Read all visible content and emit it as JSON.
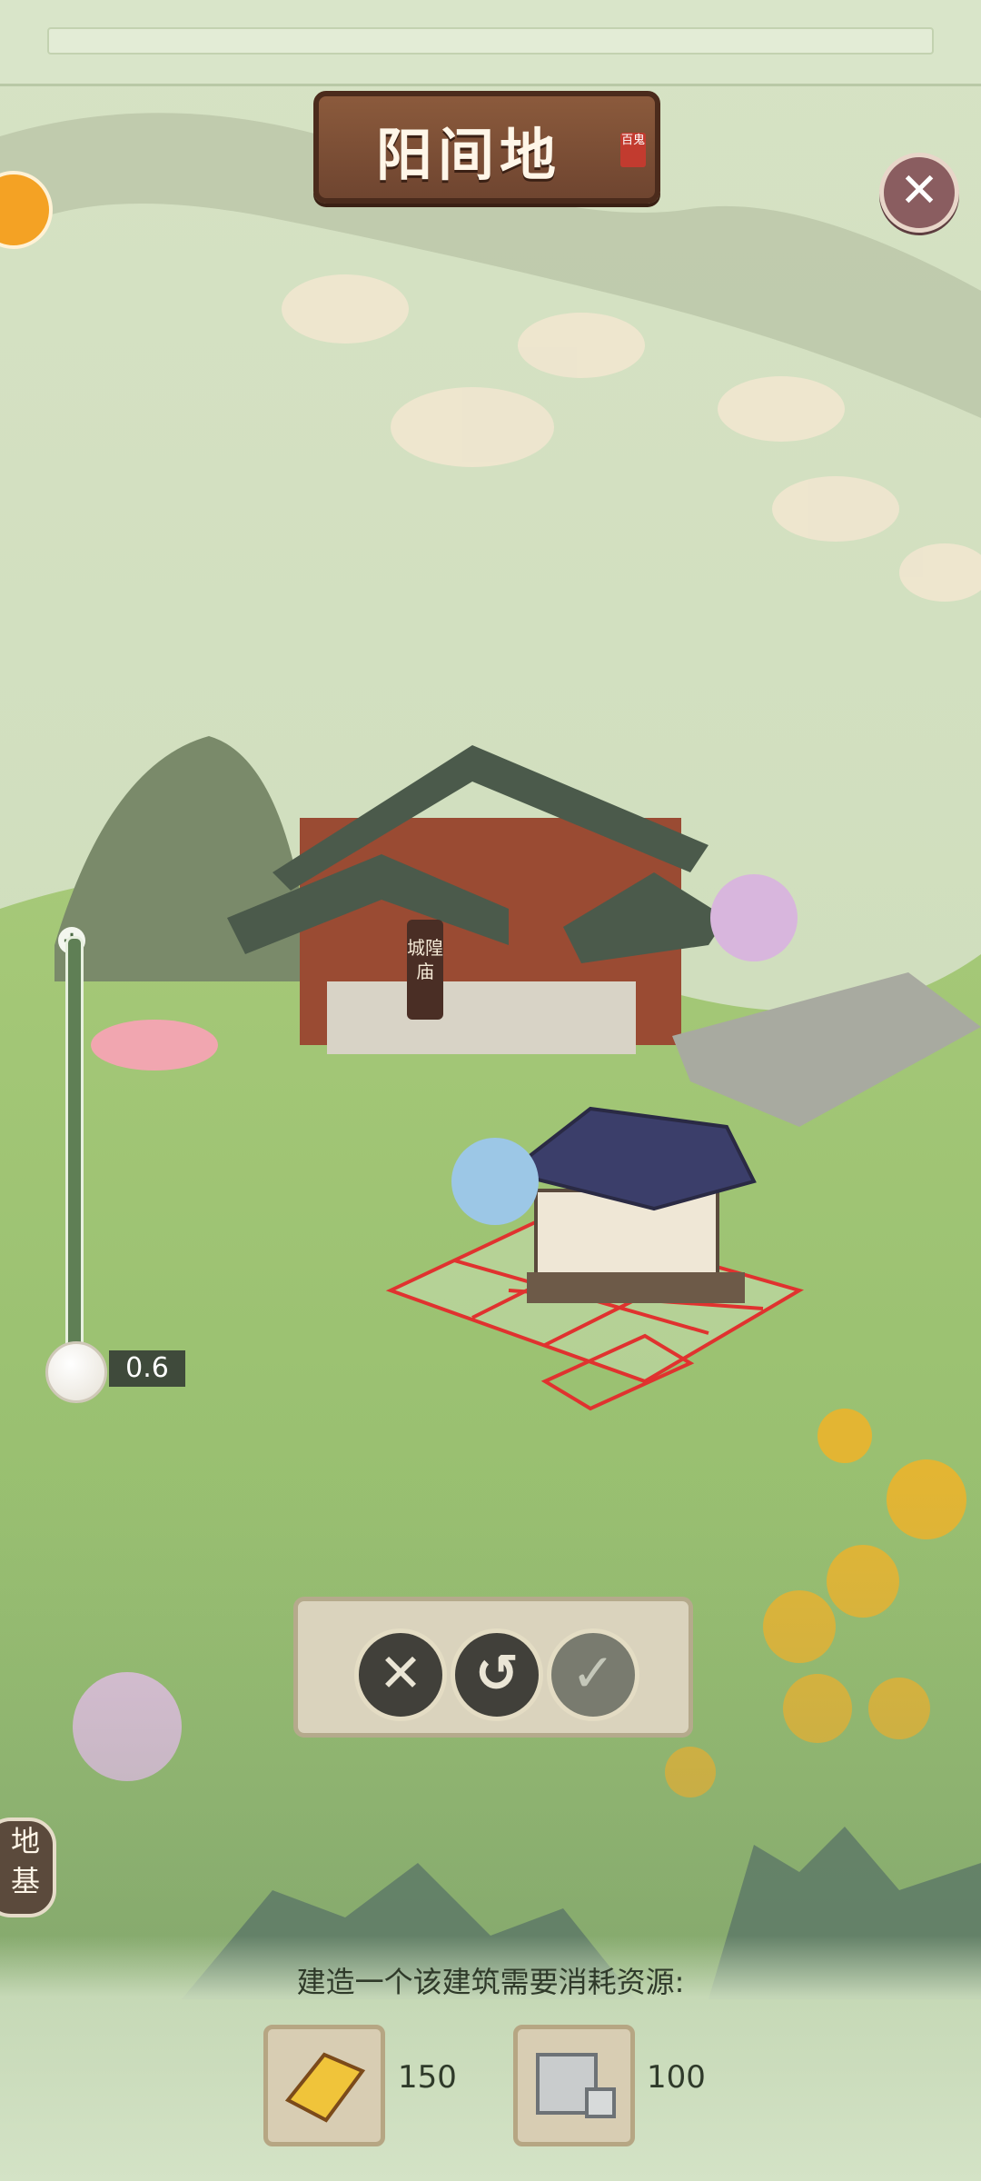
{
  "title": "阳间地",
  "title_seal": "百鬼",
  "building_label": "城隍庙",
  "zoom": {
    "value_text": "0.6",
    "plus_label": "+"
  },
  "build_controls": {
    "cancel": "✕",
    "rotate": "↺",
    "confirm": "✓"
  },
  "left_tab": "地基",
  "resources": {
    "caption": "建造一个该建筑需要消耗资源:",
    "items": [
      {
        "icon": "paper-talisman-icon",
        "count": "150"
      },
      {
        "icon": "stone-block-icon",
        "count": "100"
      }
    ]
  },
  "colors": {
    "grass": "#8fbc5f",
    "placement_grid": "#e0322f",
    "panel": "#ded5c2",
    "plaque": "#7a4b33"
  }
}
